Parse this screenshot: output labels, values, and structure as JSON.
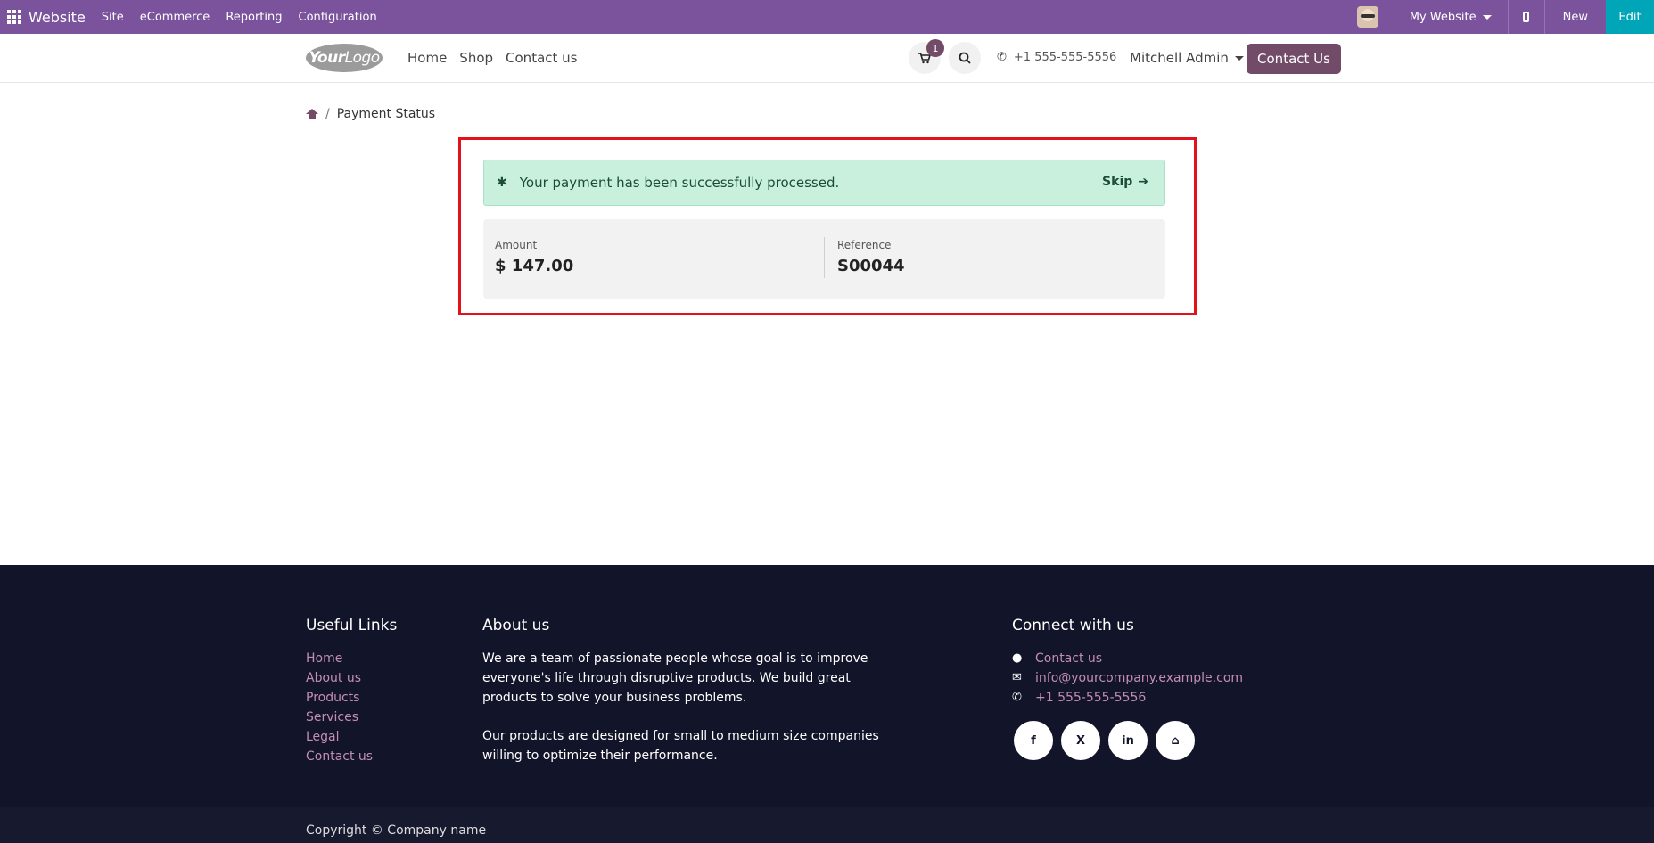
{
  "admin_bar": {
    "brand": "Website",
    "menu": [
      "Site",
      "eCommerce",
      "Reporting",
      "Configuration"
    ],
    "website_switch": "My Website",
    "new_label": "New",
    "edit_label": "Edit"
  },
  "header": {
    "logo_text_bold": "Your",
    "logo_text_light": "Logo",
    "nav": [
      "Home",
      "Shop",
      "Contact us"
    ],
    "cart_count": "1",
    "phone": "+1 555-555-5556",
    "user": "Mitchell Admin",
    "contact_button": "Contact Us"
  },
  "breadcrumb": {
    "current": "Payment Status"
  },
  "status": {
    "message": "Your payment has been successfully processed.",
    "skip_label": "Skip",
    "amount_label": "Amount",
    "amount_value": "$ 147.00",
    "reference_label": "Reference",
    "reference_value": "S00044"
  },
  "footer": {
    "useful_links_title": "Useful Links",
    "useful_links": [
      "Home",
      "About us",
      "Products",
      "Services",
      "Legal",
      "Contact us"
    ],
    "about_title": "About us",
    "about_p1": "We are a team of passionate people whose goal is to improve everyone's life through disruptive products. We build great products to solve your business problems.",
    "about_p2": "Our products are designed for small to medium size companies willing to optimize their performance.",
    "connect_title": "Connect with us",
    "connect_contact": "Contact us",
    "connect_email": "info@yourcompany.example.com",
    "connect_phone": "+1 555-555-5556",
    "social": [
      "f",
      "X",
      "in",
      "⌂"
    ],
    "copyright": "Copyright © Company name"
  }
}
